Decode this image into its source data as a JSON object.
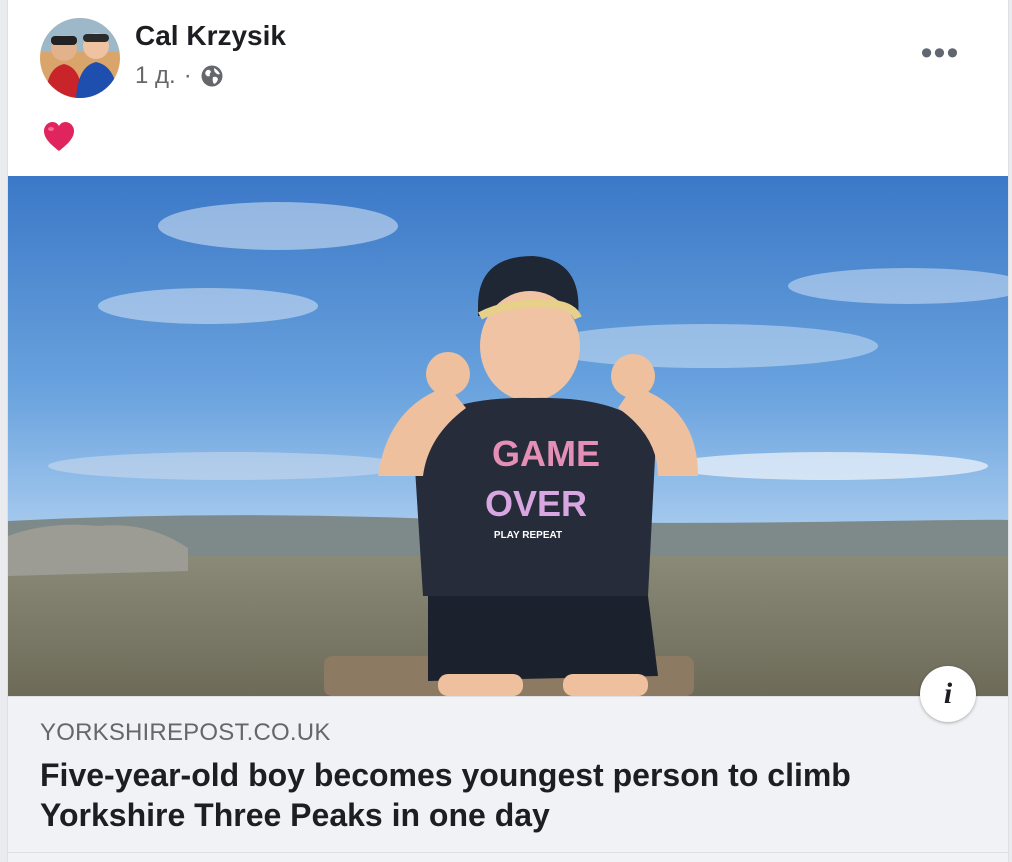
{
  "post": {
    "author": "Cal Krzysik",
    "time": "1 д.",
    "separator": "·",
    "privacy_icon": "globe-icon",
    "more_icon": "more-horizontal-icon",
    "more_label": "•••",
    "reaction_icon": "heart-emoji",
    "colors": {
      "heart": "#e0245e",
      "text": "#1c1e21",
      "secondary": "#65676b"
    }
  },
  "link_preview": {
    "domain": "YORKSHIREPOST.CO.UK",
    "title": "Five-year-old boy becomes youngest person to climb Yorkshire Three Peaks in one day",
    "info_label": "i"
  },
  "photo": {
    "shirt_text_1": "GAME",
    "shirt_text_2": "OVER",
    "shirt_text_3": "PLAY REPEAT"
  }
}
